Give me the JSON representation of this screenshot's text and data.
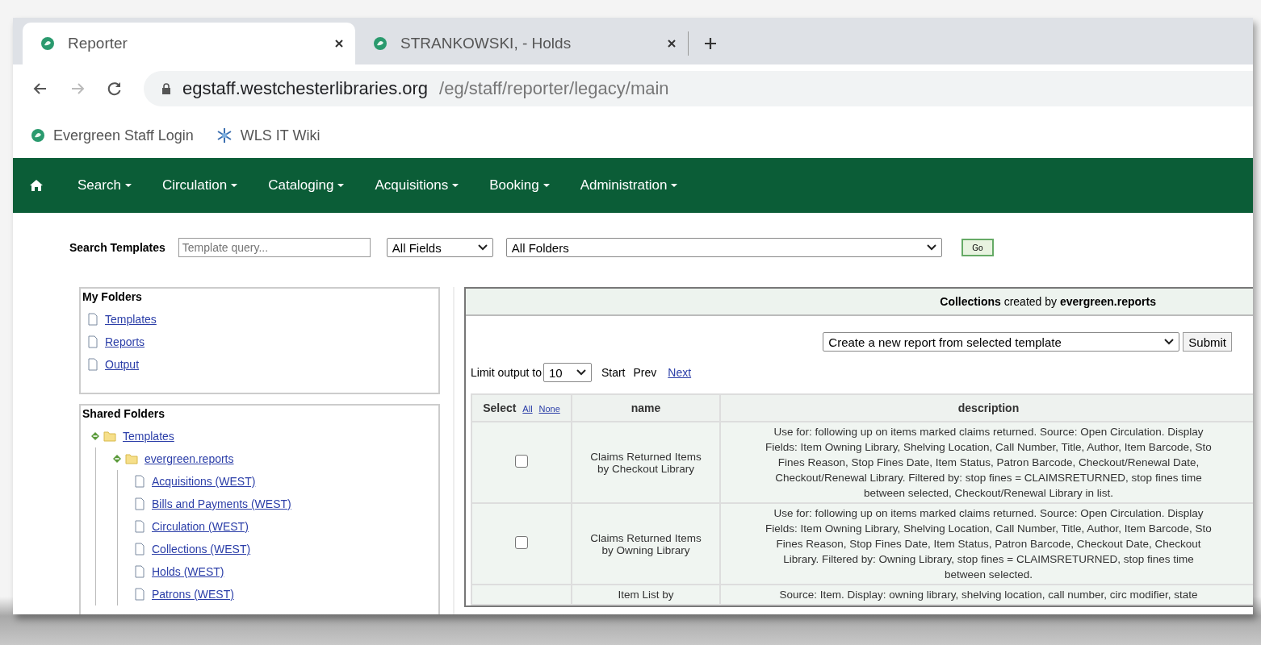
{
  "browser": {
    "tabs": [
      {
        "title": "Reporter",
        "selected": true
      },
      {
        "title": "STRANKOWSKI, - Holds",
        "selected": false
      }
    ],
    "address": {
      "host": "egstaff.westchesterlibraries.org",
      "path": "/eg/staff/reporter/legacy/main"
    },
    "bookmarks": [
      {
        "kind": "evergreen",
        "label": "Evergreen Staff Login"
      },
      {
        "kind": "snowflake",
        "label": "WLS IT Wiki"
      }
    ]
  },
  "navbar": {
    "items": [
      "Search",
      "Circulation",
      "Cataloging",
      "Acquisitions",
      "Booking",
      "Administration"
    ]
  },
  "search": {
    "label": "Search Templates",
    "placeholder": "Template query...",
    "field_select": "All Fields",
    "folder_select": "All Folders",
    "go": "Go"
  },
  "my_folders": {
    "title": "My Folders",
    "items": [
      "Templates",
      "Reports",
      "Output"
    ]
  },
  "shared_folders": {
    "title": "Shared Folders",
    "tree": [
      {
        "label": "Templates",
        "expanded": true,
        "children": [
          {
            "label": "evergreen.reports",
            "expanded": true,
            "children": [
              {
                "label": "Acquisitions (WEST)"
              },
              {
                "label": "Bills and Payments (WEST)"
              },
              {
                "label": "Circulation (WEST)"
              },
              {
                "label": "Collections (WEST)"
              },
              {
                "label": "Holds (WEST)"
              },
              {
                "label": "Patrons (WEST)"
              }
            ]
          }
        ]
      }
    ]
  },
  "collection": {
    "header": "**Collections** created by **evergreen.reports**",
    "action_select": "Create a new report from selected template",
    "submit": "Submit",
    "limit": {
      "label": "Limit output to",
      "value": "10",
      "start": "Start",
      "prev": "Prev",
      "next": "Next"
    },
    "table": {
      "select_column": {
        "label": "Select",
        "all": "All",
        "none": "None"
      },
      "columns": [
        "name",
        "description"
      ],
      "rows": [
        {
          "checked": false,
          "name": "Claims Returned Items by Checkout Library",
          "description": [
            "Use for: following up on items marked claims returned. Source: Open Circulation. Display",
            "Fields: Item Owning Library, Shelving Location, Call Number, Title, Author, Item Barcode, Sto",
            "Fines Reason, Stop Fines Date, Item Status, Patron Barcode, Checkout/Renewal Date,",
            "Checkout/Renewal Library. Filtered by: stop fines = CLAIMSRETURNED, stop fines time",
            "between selected, Checkout/Renewal Library in list."
          ]
        },
        {
          "checked": false,
          "name": "Claims Returned Items by Owning Library",
          "description": [
            "Use for: following up on items marked claims returned. Source: Open Circulation. Display",
            "Fields: Item Owning Library, Shelving Location, Call Number, Title, Author, Item Barcode, Sto",
            "Fines Reason, Stop Fines Date, Item Status, Patron Barcode, Checkout Date, Checkout",
            "Library. Filtered by: Owning Library, stop fines = CLAIMSRETURNED, stop fines time",
            "between selected."
          ]
        },
        {
          "name": "Item List by",
          "description": [
            "Source: Item. Display: owning library, shelving location, call number, circ modifier, state"
          ]
        }
      ]
    }
  }
}
